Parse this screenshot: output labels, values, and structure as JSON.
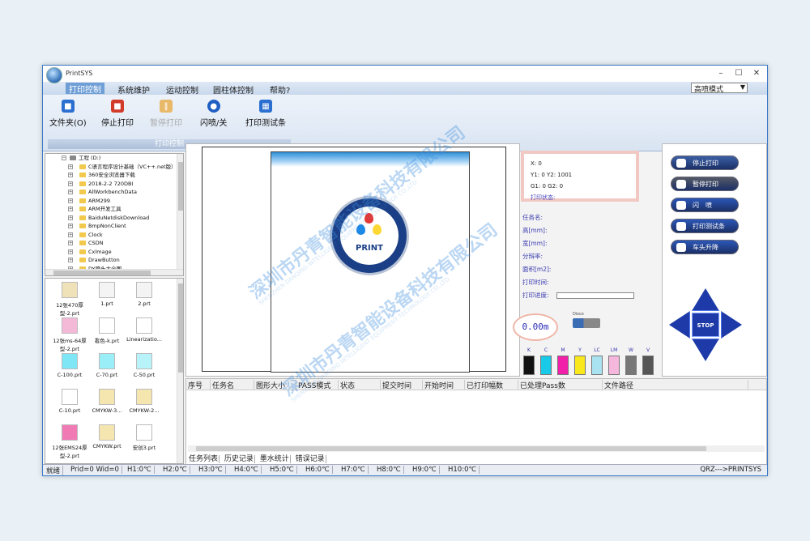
{
  "window": {
    "title": "PrintSYS",
    "controls": [
      "–",
      "☐",
      "✕"
    ]
  },
  "menu": {
    "items": [
      "打印控制",
      "系统维护",
      "运动控制",
      "圆柱体控制",
      "帮助?"
    ],
    "mode_value": "高喷模式"
  },
  "ribbon": {
    "buttons": [
      "文件夹(O)",
      "停止打印",
      "暂停打印",
      "闪喷/关",
      "打印测试条"
    ],
    "group_label": "打印控制"
  },
  "tree": {
    "root": "工程 (D:)",
    "items": [
      "C语言程序设计基础（VC++.net版）1",
      "360安全浏览器下载",
      "2018-2-2  720DBI",
      "AllWorkbenchData",
      "ARM299",
      "ARM开发工具",
      "BaiduNetdiskDownload",
      "BmpNonClient",
      "Clock",
      "CSDN",
      "Cxlmage",
      "DrawButton",
      "DY喷头大全图"
    ]
  },
  "files": [
    {
      "name": "12张470厚型-2.prt",
      "color": "#efe2b8"
    },
    {
      "name": "1.prt",
      "color": "#f4f4f4"
    },
    {
      "name": "2.prt",
      "color": "#f4f4f4"
    },
    {
      "name": "12张ms-64厚型-2.prt",
      "color": "#f3b9d6"
    },
    {
      "name": "看色-k.prt",
      "color": "#ffffff"
    },
    {
      "name": "Linearizatio...",
      "color": "#ffffff"
    },
    {
      "name": "C-100.prt",
      "color": "#7fe6f5"
    },
    {
      "name": "C-70.prt",
      "color": "#9aeef7"
    },
    {
      "name": "C-50.prt",
      "color": "#b8f3fa"
    },
    {
      "name": "C-10.prt",
      "color": "#ffffff"
    },
    {
      "name": "CMYKW-3...",
      "color": "#f5e6b0"
    },
    {
      "name": "CMYKW-2...",
      "color": "#f5e6b0"
    },
    {
      "name": "12张EMS24厚型-2.prt",
      "color": "#f07bb4"
    },
    {
      "name": "CMYKW.prt",
      "color": "#f5e6b0"
    },
    {
      "name": "安创3.prt",
      "color": "#ffffff"
    }
  ],
  "logo": {
    "text": "PRINT",
    "ring": "Q R Z"
  },
  "info": {
    "x": "X: 0",
    "y": "Y1: 0 Y2: 1001",
    "g": "G1: 0 G2: 0",
    "state": "打印状态:"
  },
  "props": [
    "任务名:",
    "高[mm]:",
    "宽[mm]:",
    "分辩率:",
    "面积[m2]:",
    "打印时间:",
    "打印进度:"
  ],
  "speed": "0.00m",
  "disco": "Disco",
  "inks": [
    {
      "label": "K",
      "color": "#111111"
    },
    {
      "label": "C",
      "color": "#19c9e8"
    },
    {
      "label": "M",
      "color": "#f020a8"
    },
    {
      "label": "Y",
      "color": "#f8e81c"
    },
    {
      "label": "LC",
      "color": "#a9e2f0"
    },
    {
      "label": "LM",
      "color": "#f6b7dd"
    },
    {
      "label": "W",
      "color": "#777777"
    },
    {
      "label": "V",
      "color": "#555555"
    }
  ],
  "panel_buttons": [
    {
      "label": "停止打印",
      "color": "#3b5fa5"
    },
    {
      "label": "暂停打印",
      "color": "#555a66"
    },
    {
      "label": "闪　喷",
      "color": "#2c57b8"
    },
    {
      "label": "打印测试条",
      "color": "#2c57b8"
    },
    {
      "label": "车头升降",
      "color": "#2c57b8"
    }
  ],
  "stop_label": "STOP",
  "task_columns": [
    "序号",
    "任务名",
    "图形大小",
    "PASS模式",
    "状态",
    "提交时间",
    "开始时间",
    "已打印幅数",
    "已处理Pass数",
    "文件路径"
  ],
  "task_tabs": [
    "任务列表",
    "历史记录",
    "墨水统计",
    "错误记录"
  ],
  "status": {
    "fields": [
      "就绪",
      "Prid=0 Wid=0",
      "H1:0℃",
      "H2:0℃",
      "H3:0℃",
      "H4:0℃",
      "H5:0℃",
      "H6:0℃",
      "H7:0℃",
      "H8:0℃",
      "H9:0℃",
      "H10:0℃"
    ],
    "right": "QRZ--->PRINTSYS"
  },
  "watermark": {
    "main": "深圳市丹青智能设备科技有限公司",
    "sub": "SHENZHEN DANQING INTELLIGENT EQUIPMENT TECHNOLOGY CO.,LTD"
  }
}
